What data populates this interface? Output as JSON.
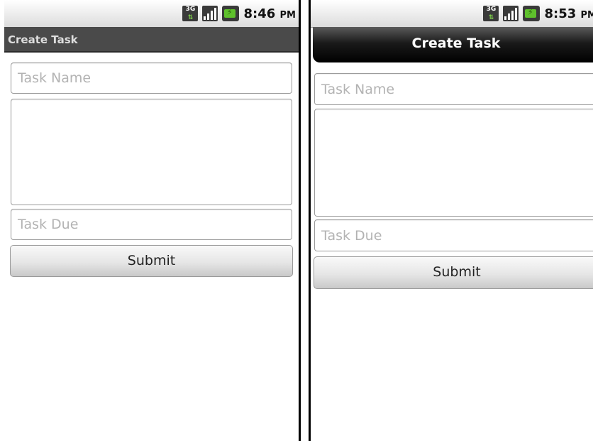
{
  "screens": [
    {
      "status": {
        "time": "8:46",
        "ampm": "PM"
      },
      "title": "Create Task",
      "form": {
        "task_name_placeholder": "Task Name",
        "description_value": "",
        "task_due_placeholder": "Task Due",
        "submit_label": "Submit"
      }
    },
    {
      "status": {
        "time": "8:53",
        "ampm": "PM"
      },
      "title": "Create Task",
      "form": {
        "task_name_placeholder": "Task Name",
        "description_value": "",
        "task_due_placeholder": "Task Due",
        "submit_label": "Submit"
      }
    }
  ],
  "icons": [
    "3g-icon",
    "signal-icon",
    "battery-charging-icon"
  ]
}
